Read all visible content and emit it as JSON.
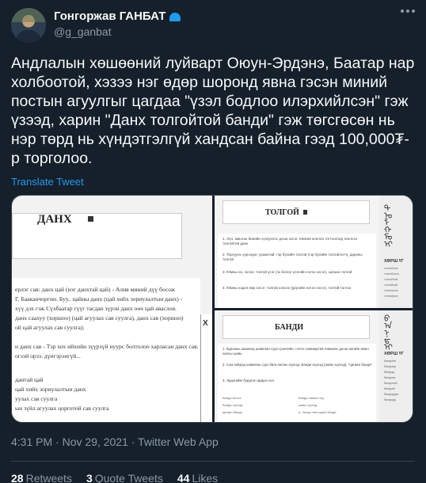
{
  "author": {
    "display_name": "Гонгоржав ГАНБАТ",
    "handle": "@g_ganbat",
    "badge_color": "#1d9bf0"
  },
  "tweet": {
    "text": "Андлалын хөшөөний луйварт Оюун-Эрдэнэ, Баатар нар холбоотой, хэзээ нэг өдөр шоронд явна гэсэн миний постын агуулгыг цагдаа \"үзэл бодлоо илэрхийлсэн\" гэж үзээд, харин \"Данх толгойтой банди\" гэж төгсгөсөн нь нэр төрд нь хүндэтгэлгүй хандсан байна гээд 100,000₮-р торголоо.",
    "translate_label": "Translate Tweet",
    "timestamp": "4:31 PM · Nov 29, 2021 · Twitter Web App"
  },
  "media": {
    "image1": {
      "title": "ДАНХ",
      "lines": [
        "ерлэг сав: данх цай (нэг данхтай цай) - Алив миний дүү босож",
        "Г. Бааканчоргин. Буу.. цайны данх (цай хийх зориулалтын данх) -",
        "хүү дэх гэж Сүхбаатар гүүг тасдан зүрэн данх оөч цай аваслов.",
        "данх саахуу (хоршоо) (цай агуулах сав суулга), данх сав (хоршоо)",
        "ой цай агуулах сав суулга);",
        "",
        "н данх сав - Тэр хох ийхийн зүүрзүй нуурс болтолоо харласан данх сав.",
        "огзэй орзэ. дүнгэрэнгүй...",
        "",
        "дантай цай",
        "цай хийх зориулалтын данх",
        "уулах сав суулга",
        "ын зүйл агуулах цорготой сав суулга"
      ],
      "side_letter": "Х"
    },
    "image2": {
      "title": "ТОЛГОЙ",
      "paragraphs": [
        "1. Хүн, амьтны биеийн хүзүүнээс дээш хэсэг. Хөөгөө хоолоо тогтоогоод эхэлсэн толгойтой данх",
        "2. Торгууль үүрэлдэг, ухаантай: гэр бүлийн толгой (гэр бүлийн толгойлогч), дархны толгой",
        "3. Юмны оо, эхлэх: толгой үсэг (эх болох үсэгийн нэгэн хэсэг), цагаан толгой",
        "4. Юмны хэдэн өөр хэсэг: толгой хэлхэх (уругийн нэгэн хэсэг), толгой тоглох"
      ],
      "side_head": "ХӨРШ ҮГ",
      "side_items": [
        "толгойлох",
        "толгойлогч",
        "толгойтой",
        "толгойгүй",
        "толгоорох",
        "толгойрох"
      ]
    },
    "image3": {
      "title": "БАНДИ",
      "paragraphs": [
        "1. Бурханы шашинд шавилан суух цээнгийн, гэлэн санваартай ламхаас доош ангийн ижил насны шавь.",
        "2. Сүм хийдэд шавилан суух бага насны хүүхэд. Банди хүүхэд (шавь хүүхэд), \"цагаан банди\"",
        "3. Эрдэнийн бүрдсэн ардын хэл."
      ],
      "columns": [
        [
          "Банди болох",
          "Банди ламын хүү"
        ],
        [
          "Банди хүүхэд",
          "шавь хүүхэд"
        ],
        [
          "цагаан банди",
          "а. Залуу ном сурах банди"
        ]
      ],
      "side_head": "ХӨРШ ҮГ",
      "side_items": [
        "бандийн",
        "бандиар",
        "бандид",
        "бандиас",
        "бандитай",
        "бандийг",
        "бандиудыг",
        "бандиуд"
      ]
    }
  },
  "stats": {
    "retweets_count": "28",
    "retweets_label": "Retweets",
    "quotes_count": "3",
    "quotes_label": "Quote Tweets",
    "likes_count": "44",
    "likes_label": "Likes"
  }
}
